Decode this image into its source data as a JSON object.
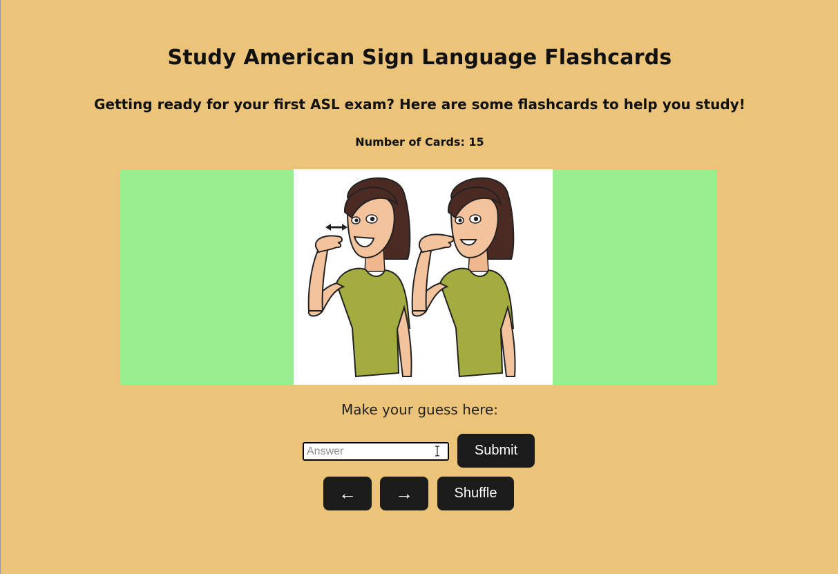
{
  "header": {
    "title": "Study American Sign Language Flashcards",
    "subtitle": "Getting ready for your first ASL exam? Here are some flashcards to help you study!",
    "card_count": "Number of Cards: 15"
  },
  "card": {
    "background_color": "#99ee90",
    "image_icon": "asl-sign-illustration"
  },
  "guess": {
    "label": "Make your guess here:",
    "answer_placeholder": "Answer",
    "answer_value": "",
    "submit_label": "Submit"
  },
  "navigation": {
    "prev_label": "←",
    "next_label": "→",
    "shuffle_label": "Shuffle"
  },
  "colors": {
    "page_background": "#ebc479",
    "button_background": "#1b1b1b",
    "button_text": "#ffffff"
  }
}
